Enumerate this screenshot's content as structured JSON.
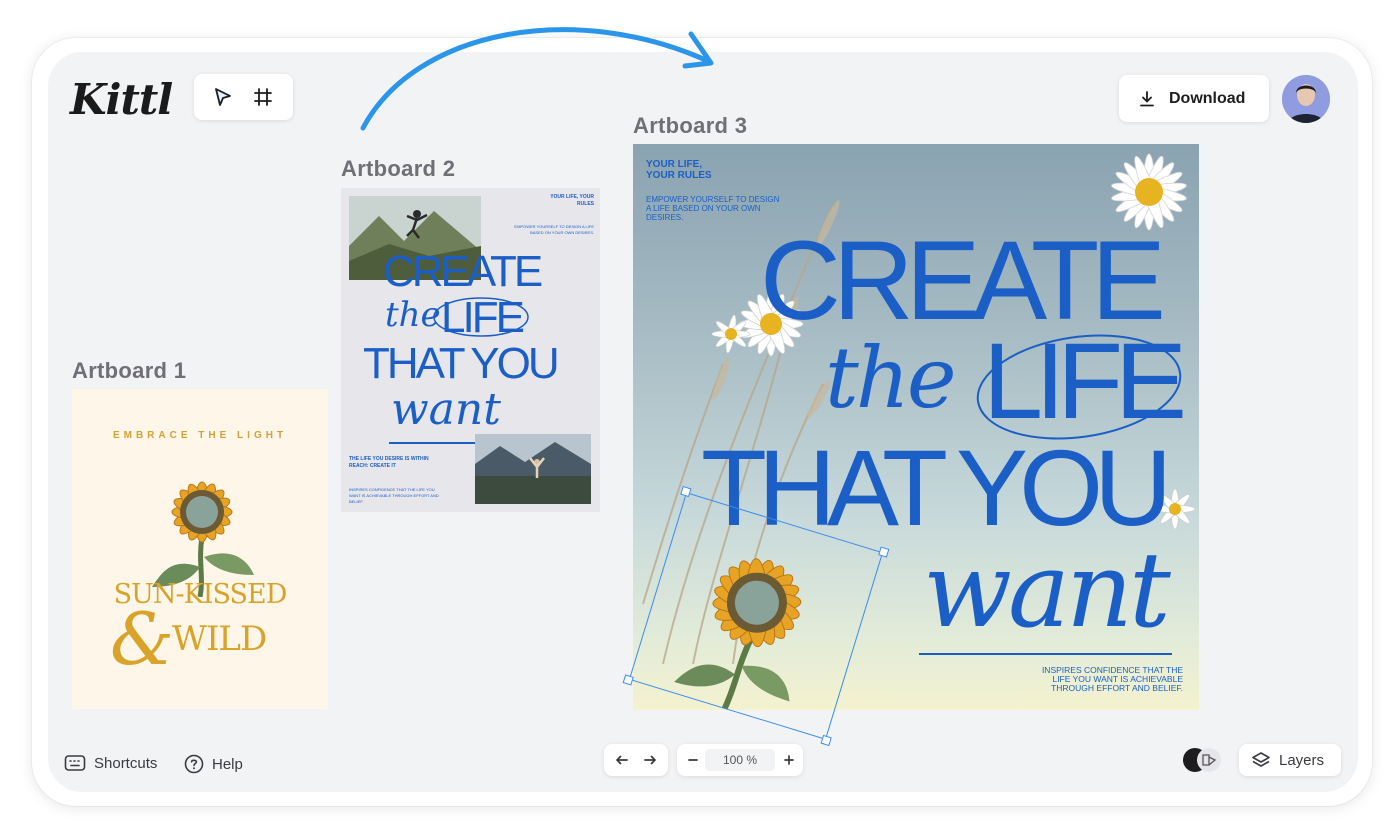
{
  "app": {
    "logo": "Kittl"
  },
  "toolbar": {
    "select_tool": "select-tool",
    "frame_tool": "frame-tool"
  },
  "header": {
    "download_label": "Download"
  },
  "artboards": {
    "a1": {
      "label": "Artboard 1",
      "tagline": "EMBRACE THE LIGHT",
      "title_line1": "SUN-KISSED",
      "title_line2": "WILD"
    },
    "a2": {
      "label": "Artboard 2",
      "corner_top": "YOUR LIFE, YOUR RULES",
      "corner_sub": "EMPOWER YOURSELF TO DESIGN A LIFE BASED ON YOUR OWN DESIRES.",
      "line_create": "CREATE",
      "line_the": "the",
      "line_life": "LIFE",
      "line_that": "THAT YOU",
      "line_want": "want",
      "bottom_head": "THE LIFE YOU DESIRE IS WITHIN REACH: CREATE IT",
      "bottom_sub": "INSPIRES CONFIDENCE THAT THE LIFE YOU WANT IS ACHIEVABLE THROUGH EFFORT AND BELIEF."
    },
    "a3": {
      "label": "Artboard 3",
      "top_line1": "YOUR LIFE,",
      "top_line2": "YOUR RULES",
      "sub_line1": "EMPOWER YOURSELF TO DESIGN",
      "sub_line2": "A LIFE BASED ON YOUR OWN",
      "sub_line3": "DESIRES.",
      "line_create": "CREATE",
      "line_the": "the",
      "line_life": "LIFE",
      "line_that": "THAT YOU",
      "line_want": "want",
      "foot_line1": "INSPIRES CONFIDENCE THAT THE",
      "foot_line2": "LIFE YOU WANT IS ACHIEVABLE",
      "foot_line3": "THROUGH EFFORT AND BELIEF."
    }
  },
  "footer": {
    "shortcuts_label": "Shortcuts",
    "help_label": "Help",
    "zoom_value": "100 %",
    "layers_label": "Layers"
  },
  "colors": {
    "accent": "#1b5fc6",
    "arrow": "#2b95ea",
    "selection": "#3b8bef",
    "sunflower_gold": "#d9a32a"
  }
}
